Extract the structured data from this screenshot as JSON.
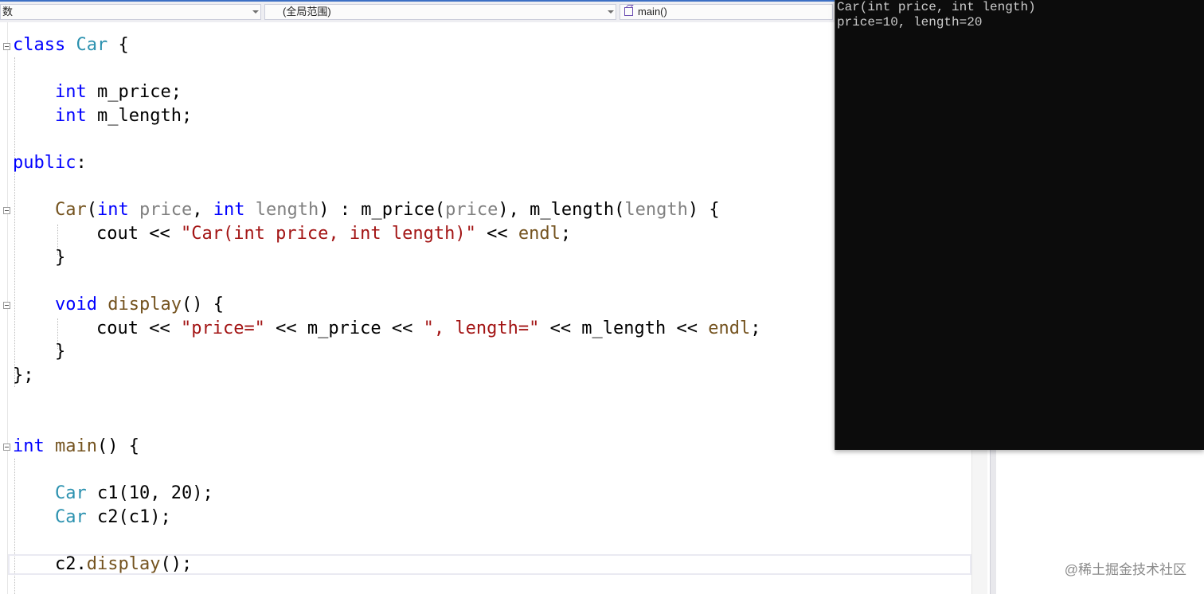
{
  "navbar": {
    "project_label": "数",
    "scope_label": "(全局范围)",
    "member_label": "main()"
  },
  "code": {
    "l1": {
      "kw": "class",
      "sp": " ",
      "ty": "Car",
      "rest": " {"
    },
    "l3": {
      "kw": "int",
      "rest": " m_price;"
    },
    "l4": {
      "kw": "int",
      "rest": " m_length;"
    },
    "l6": {
      "kw": "public",
      "rest": ":"
    },
    "l8": {
      "fn": "Car",
      "p1": "(",
      "k1": "int",
      "s1": " ",
      "a1": "price",
      "c1": ", ",
      "k2": "int",
      "s2": " ",
      "a2": "length",
      "r1": ") : ",
      "f2": "m_price",
      "p2": "(",
      "a3": "price",
      "r2": "), ",
      "f3": "m_length",
      "p3": "(",
      "a4": "length",
      "r3": ") {"
    },
    "l9": {
      "pre": "cout << ",
      "str": "\"Car(int price, int length)\"",
      "mid": " << ",
      "fn": "endl",
      "end": ";"
    },
    "l10": {
      "text": "}"
    },
    "l12": {
      "kw": "void",
      "sp": " ",
      "fn": "display",
      "rest": "() {"
    },
    "l13": {
      "pre": "cout << ",
      "s1": "\"price=\"",
      "m1": " << m_price << ",
      "s2": "\", length=\"",
      "m2": " << m_length << ",
      "fn": "endl",
      "end": ";"
    },
    "l14": {
      "text": "}"
    },
    "l15": {
      "text": "};"
    },
    "l18": {
      "kw": "int",
      "sp": " ",
      "fn": "main",
      "rest": "() {"
    },
    "l20": {
      "ty": "Car",
      "rest": " c1(10, 20);"
    },
    "l21": {
      "ty": "Car",
      "rest": " c2(c1);"
    },
    "l23": {
      "pre": "c2.",
      "fn": "display",
      "rest": "();"
    }
  },
  "console": {
    "lines": [
      "Car(int price, int length)",
      "price=10, length=20"
    ]
  },
  "watermark": "@稀土掘金技术社区",
  "colors": {
    "keyword": "#0000ff",
    "type": "#2b91af",
    "function": "#74531f",
    "parameter": "#808080",
    "string": "#a31515",
    "console_bg": "#0c0c0c",
    "console_text": "#cccccc"
  }
}
